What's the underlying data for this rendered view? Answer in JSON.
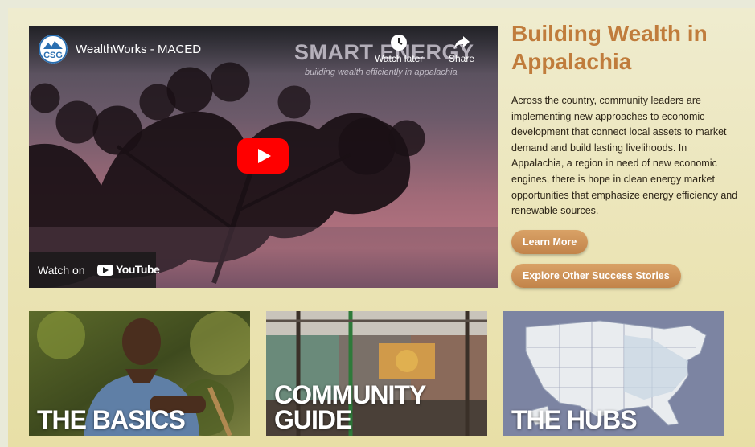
{
  "video": {
    "channel_logo_text": "CSG",
    "title": "WealthWorks - MACED",
    "overlay_title": "SMART ENERGY",
    "overlay_subtitle": "building wealth efficiently in appalachia",
    "watch_later_label": "Watch later",
    "share_label": "Share",
    "watch_on_label": "Watch on",
    "youtube_label": "YouTube"
  },
  "article": {
    "headline": "Building Wealth in Appalachia",
    "body": "Across the country, community leaders are implementing new approaches to economic development that connect local assets to market demand and build lasting livelihoods. In Appalachia, a region in need of new economic engines, there is hope in clean energy market opportunities that emphasize energy efficiency and renewable sources.",
    "learn_more_label": "Learn More",
    "explore_label": "Explore Other Success Stories"
  },
  "tiles": [
    {
      "label": "THE BASICS"
    },
    {
      "label_line1": "COMMUNITY",
      "label_line2": "GUIDE"
    },
    {
      "label": "THE HUBS"
    }
  ],
  "colors": {
    "accent": "#c07c3c",
    "button": "#c98c50",
    "play": "#ff0000"
  }
}
